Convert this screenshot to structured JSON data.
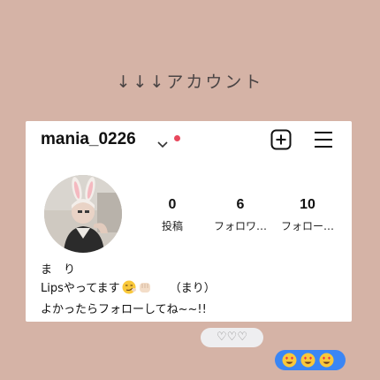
{
  "heading": "↓↓↓アカウント",
  "profile": {
    "username": "mania_0226",
    "stats": [
      {
        "value": "0",
        "label": "投稿"
      },
      {
        "value": "6",
        "label": "フォロワ…"
      },
      {
        "value": "10",
        "label": "フォロー…"
      }
    ],
    "bio": {
      "name": "ま　り",
      "line2": "Lipsやってます",
      "line2_suffix": "（まり）",
      "line3": "よかったらフォローしてね~~!!"
    }
  },
  "messages": {
    "grey": "♡♡♡"
  },
  "colors": {
    "background": "#d5b3a6",
    "card": "#ffffff",
    "notification_dot": "#e8485d",
    "bubble_blue": "#3a86f5",
    "bubble_grey": "#eeeef0"
  },
  "icons": [
    "chevron-down-icon",
    "add-post-icon",
    "menu-icon",
    "emoji-smirk",
    "emoji-fist",
    "emoji-heart-eyes"
  ]
}
